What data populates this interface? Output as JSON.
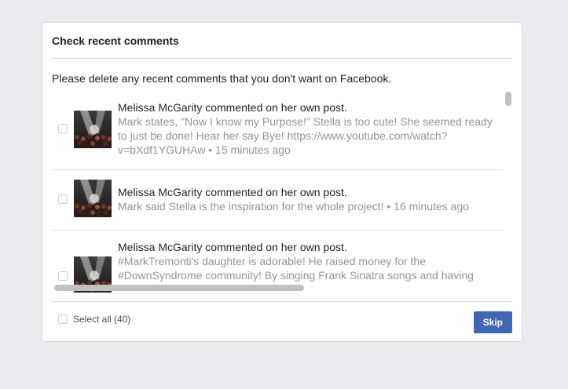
{
  "dialog": {
    "title": "Check recent comments",
    "instructions": "Please delete any recent comments that you don't want on Facebook."
  },
  "comments": [
    {
      "heading": "Melissa McGarity commented on her own post.",
      "body": "Mark states, \"Now I know my Purpose!\" Stella is too cute! She seemed ready to just be done! Hear her say Bye! https://www.youtube.com/watch?v=bXdf1YGUHAw • 15 minutes ago"
    },
    {
      "heading": "Melissa McGarity commented on her own post.",
      "body": "Mark said Stella is the inspiration for the whole project! • 16 minutes ago"
    },
    {
      "heading": "Melissa McGarity commented on her own post.",
      "body": "#MarkTremonti's daughter is adorable! He raised money for the #DownSyndrome community! By singing Frank Sinatra songs and having"
    }
  ],
  "footer": {
    "select_all_label": "Select all (40)",
    "skip_label": "Skip"
  },
  "colors": {
    "primary_button": "#4267b2",
    "secondary_text": "#90949c",
    "background": "#e9ebee"
  },
  "icons": {
    "thumbnail": "concert-photo-thumbnail",
    "checkbox": "checkbox-icon"
  }
}
